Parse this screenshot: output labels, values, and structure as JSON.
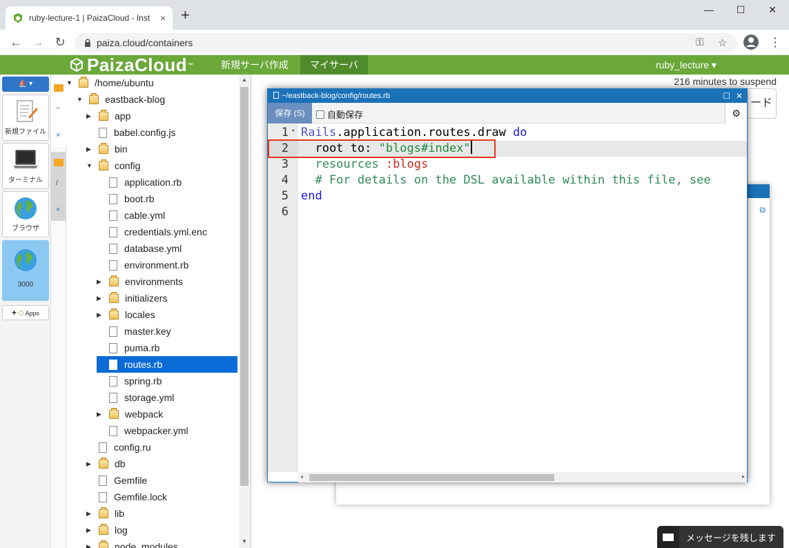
{
  "browser": {
    "tab_title": "ruby-lecture-1 | PaizaCloud - Inst",
    "tab_close": "×",
    "new_tab": "+",
    "minimize": "—",
    "maximize": "☐",
    "close": "✕",
    "url": "paiza.cloud/containers"
  },
  "header": {
    "logo": "PaizaCloud",
    "logo_tm": "™",
    "nav_new_server": "新規サーバ作成",
    "nav_my_server": "マイサーバ",
    "user": "ruby_lecture ▾"
  },
  "dock": {
    "new_file": "新規ファイル",
    "terminal": "ターミナル",
    "browser": "ブラウザ",
    "port": "3000",
    "apps": "Apps"
  },
  "tree": {
    "items": [
      {
        "label": "/home/ubuntu"
      },
      {
        "label": "eastback-blog"
      },
      {
        "label": "app"
      },
      {
        "label": "babel.config.js"
      },
      {
        "label": "bin"
      },
      {
        "label": "config"
      },
      {
        "label": "application.rb"
      },
      {
        "label": "boot.rb"
      },
      {
        "label": "cable.yml"
      },
      {
        "label": "credentials.yml.enc"
      },
      {
        "label": "database.yml"
      },
      {
        "label": "environment.rb"
      },
      {
        "label": "environments"
      },
      {
        "label": "initializers"
      },
      {
        "label": "locales"
      },
      {
        "label": "master.key"
      },
      {
        "label": "puma.rb"
      },
      {
        "label": "routes.rb"
      },
      {
        "label": "spring.rb"
      },
      {
        "label": "storage.yml"
      },
      {
        "label": "webpack"
      },
      {
        "label": "webpacker.yml"
      },
      {
        "label": "config.ru"
      },
      {
        "label": "db"
      },
      {
        "label": "Gemfile"
      },
      {
        "label": "Gemfile.lock"
      },
      {
        "label": "lib"
      },
      {
        "label": "log"
      },
      {
        "label": "node_modules"
      }
    ]
  },
  "workspace": {
    "suspend": "216 minutes to suspend",
    "bg_button": "ード"
  },
  "editor": {
    "title": "~/eastback-blog/config/routes.rb",
    "save": "保存 (S)",
    "autosave": "自動保存",
    "line_numbers": [
      "1",
      "2",
      "3",
      "4",
      "5",
      "6"
    ],
    "line1": {
      "a": "Rails",
      "b": ".application.routes.draw ",
      "c": "do"
    },
    "line2": {
      "a": "  root to: ",
      "b": "\"blogs#index\""
    },
    "line3": {
      "a": "  resources ",
      "b": ":blogs"
    },
    "line4": "  # For details on the DSL available within this file, see",
    "line5": "end"
  },
  "message": "メッセージを残します",
  "colors": {
    "paiza_green": "#6aa83a",
    "editor_blue": "#1a72b8",
    "selection_blue": "#0a6bd6",
    "highlight_red": "#e8361b"
  }
}
